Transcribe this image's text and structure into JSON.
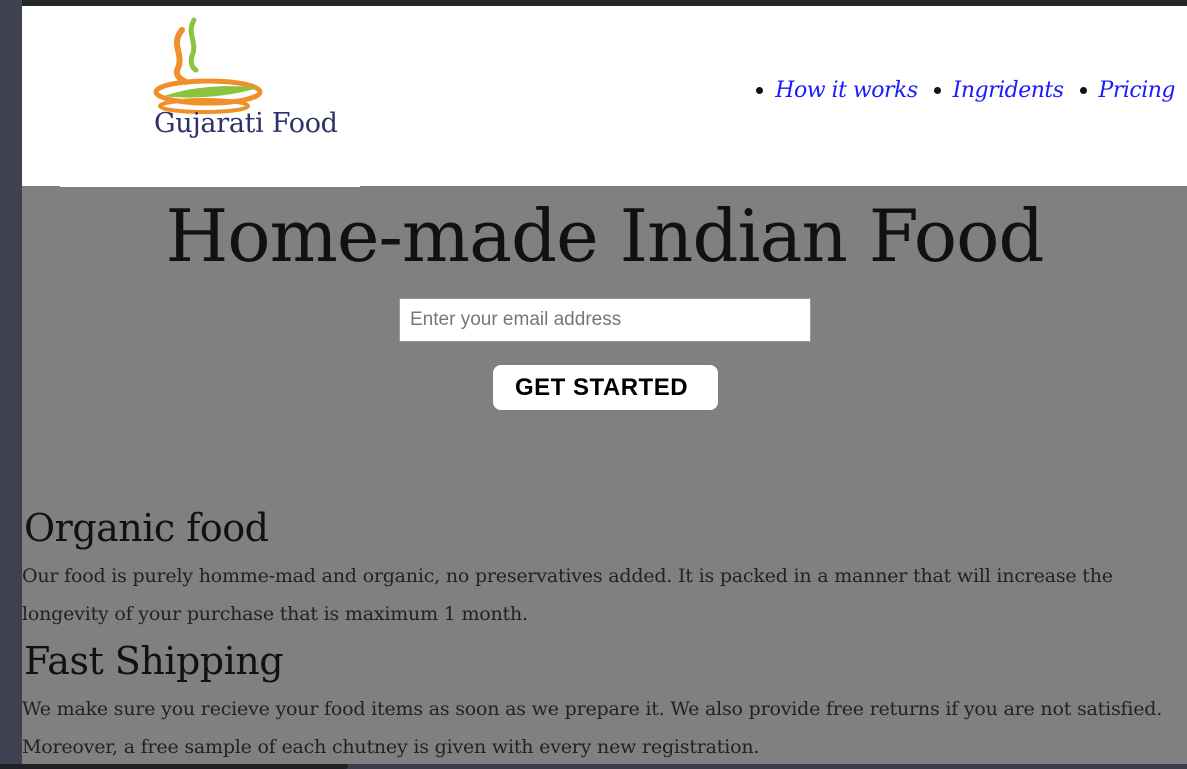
{
  "brand": {
    "name": "Gujarati Food"
  },
  "nav": {
    "items": [
      {
        "label": "How it works"
      },
      {
        "label": "Ingridents"
      },
      {
        "label": "Pricing"
      }
    ]
  },
  "hero": {
    "title": "Home-made Indian Food",
    "email_placeholder": "Enter your email address",
    "cta_label": "GET STARTED"
  },
  "features": [
    {
      "title": "Organic food",
      "body": "Our food is purely homme-mad and organic, no preservatives added. It is packed in a manner that will increase the longevity of your purchase that is maximum 1 month."
    },
    {
      "title": "Fast Shipping",
      "body": "We make sure you recieve your food items as soon as we prepare it. We also provide free returns if you are not satisfied. Moreover, a free sample of each chutney is given with every new registration."
    }
  ],
  "colors": {
    "page_background": "#808080",
    "header_background": "#ffffff",
    "nav_link": "#1a1aff",
    "logo_text": "#2d3168",
    "logo_orange": "#f0902a",
    "logo_green": "#8ac43f"
  }
}
